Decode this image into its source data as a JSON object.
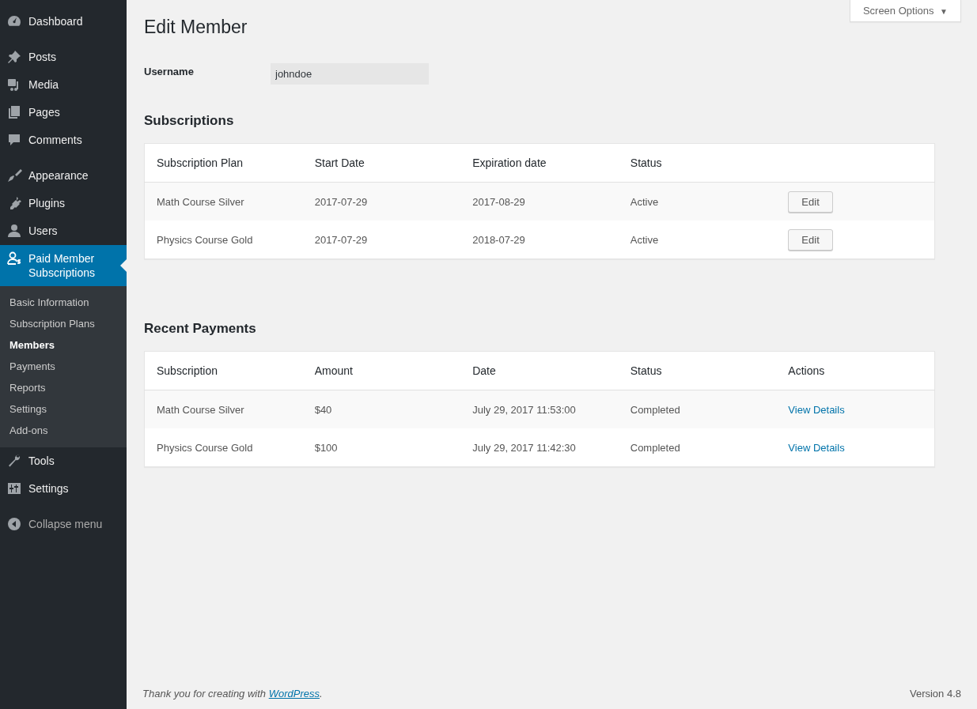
{
  "sidebar": {
    "menu_groups": [
      {
        "items": [
          {
            "label": "Dashboard",
            "kind": "gauge",
            "selected": false
          }
        ]
      },
      {
        "items": [
          {
            "label": "Posts",
            "kind": "pin",
            "selected": false
          },
          {
            "label": "Media",
            "kind": "media",
            "selected": false
          },
          {
            "label": "Pages",
            "kind": "pages",
            "selected": false
          },
          {
            "label": "Comments",
            "kind": "comment",
            "selected": false
          }
        ]
      },
      {
        "items": [
          {
            "label": "Appearance",
            "kind": "brush",
            "selected": false
          },
          {
            "label": "Plugins",
            "kind": "plug",
            "selected": false
          },
          {
            "label": "Users",
            "kind": "user",
            "selected": false
          },
          {
            "label": "Paid Member Subscriptions",
            "kind": "member",
            "selected": true,
            "submenu": [
              {
                "label": "Basic Information",
                "selected": false
              },
              {
                "label": "Subscription Plans",
                "selected": false
              },
              {
                "label": "Members",
                "selected": true
              },
              {
                "label": "Payments",
                "selected": false
              },
              {
                "label": "Reports",
                "selected": false
              },
              {
                "label": "Settings",
                "selected": false
              },
              {
                "label": "Add-ons",
                "selected": false
              }
            ]
          },
          {
            "label": "Tools",
            "kind": "wrench",
            "selected": false
          },
          {
            "label": "Settings",
            "kind": "sliders",
            "selected": false
          }
        ]
      }
    ],
    "collapse": "Collapse menu"
  },
  "screen_options": {
    "label": "Screen Options",
    "symbol": "▼"
  },
  "title": "Edit Member",
  "username": {
    "label": "Username",
    "value": "johndoe"
  },
  "subscriptions": {
    "heading": "Subscriptions",
    "columns": [
      "Subscription Plan",
      "Start Date",
      "Expiration date",
      "Status"
    ],
    "rows": [
      {
        "cells": [
          "Math Course Silver",
          "2017-07-29",
          "2017-08-29",
          "Active"
        ],
        "action": "Edit"
      },
      {
        "cells": [
          "Physics Course Gold",
          "2017-07-29",
          "2018-07-29",
          "Active"
        ],
        "action": "Edit"
      }
    ]
  },
  "payments": {
    "heading": "Recent Payments",
    "columns": [
      "Subscription",
      "Amount",
      "Date",
      "Status",
      "Actions"
    ],
    "rows": [
      {
        "cells": [
          "Math Course Silver",
          "$40",
          "July 29, 2017 11:53:00",
          "Completed"
        ],
        "action": "View Details"
      },
      {
        "cells": [
          "Physics Course Gold",
          "$100",
          "July 29, 2017 11:42:30",
          "Completed"
        ],
        "action": "View Details"
      }
    ]
  },
  "footer": {
    "thanks_text": "Thank you for creating with ",
    "thanks_link": "WordPress",
    "thanks_end": ".",
    "version": "Version 4.8"
  }
}
